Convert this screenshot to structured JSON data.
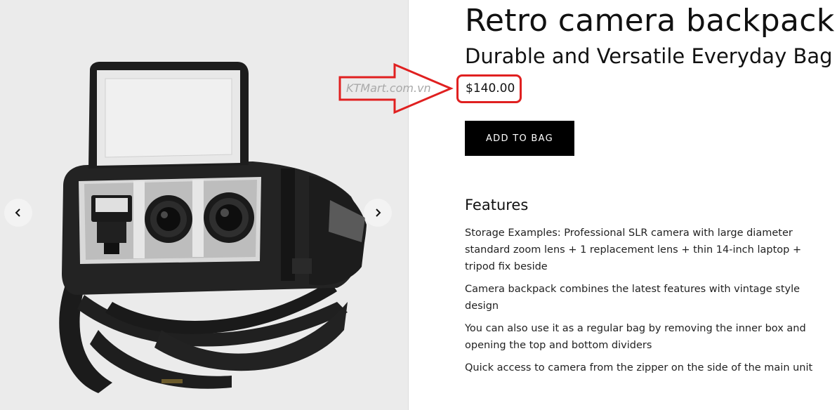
{
  "gallery": {
    "prev_icon": "chevron-left-icon",
    "next_icon": "chevron-right-icon",
    "image": "camera-backpack-photo"
  },
  "product": {
    "title": "Retro camera backpack",
    "subtitle": "Durable and Versatile Everyday Bag",
    "price": "$140.00",
    "add_to_bag_label": "ADD TO BAG"
  },
  "annotation": {
    "watermark": "KTMart.com.vn",
    "highlight_color": "#e02020"
  },
  "features": {
    "heading": "Features",
    "items": [
      "Storage Examples: Professional SLR camera with large diameter standard zoom lens + 1 replacement lens + thin 14-inch laptop + tripod fix beside",
      "Camera backpack combines the latest features with vintage style design",
      "You can also use it as a regular bag by removing the inner box and opening the top and bottom dividers",
      "Quick access to camera from the zipper on the side of the main unit"
    ]
  }
}
